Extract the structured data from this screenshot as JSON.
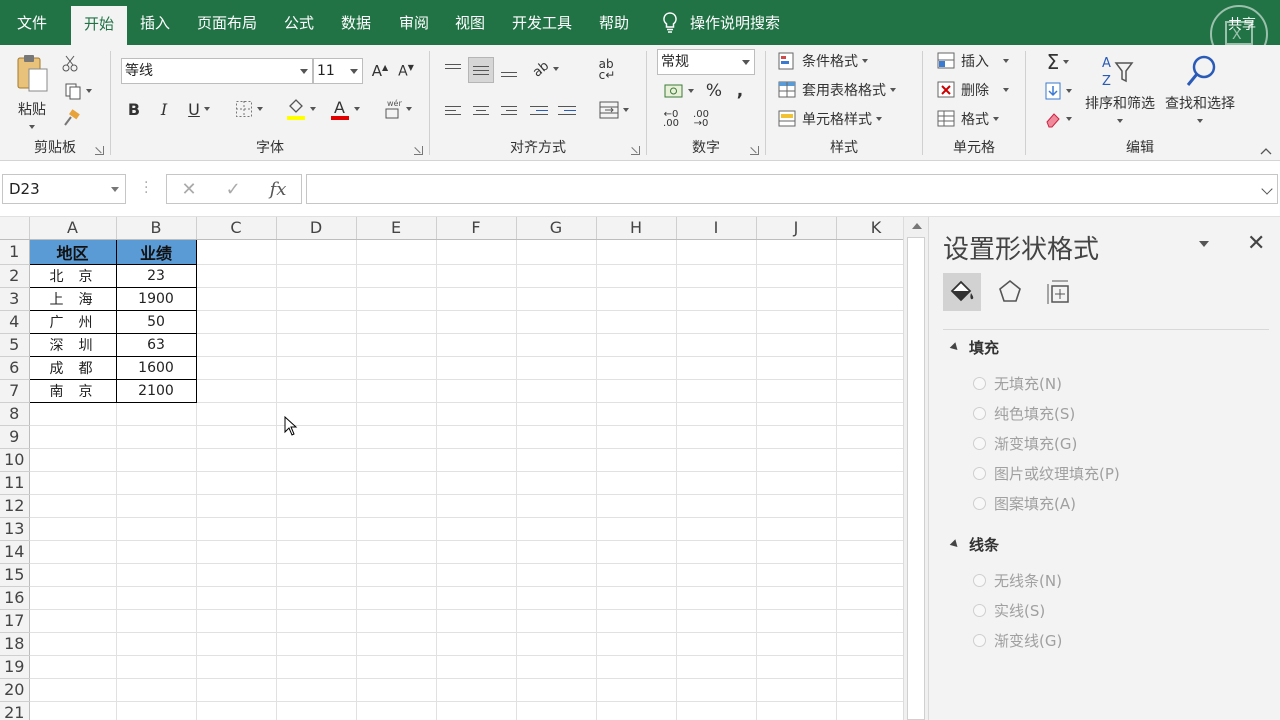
{
  "menu": {
    "tabs": [
      "文件",
      "开始",
      "插入",
      "页面布局",
      "公式",
      "数据",
      "审阅",
      "视图",
      "开发工具",
      "帮助"
    ],
    "active_tab": "开始",
    "tell_me": "操作说明搜索",
    "share": "共享",
    "brand_color": "#217346"
  },
  "ribbon": {
    "clipboard": {
      "label": "剪贴板",
      "paste": "粘贴"
    },
    "font": {
      "label": "字体",
      "font_name": "等线",
      "font_size": "11"
    },
    "alignment": {
      "label": "对齐方式"
    },
    "number": {
      "label": "数字",
      "format": "常规"
    },
    "styles": {
      "label": "样式",
      "conditional": "条件格式",
      "table": "套用表格格式",
      "cell": "单元格样式"
    },
    "cells": {
      "label": "单元格",
      "insert": "插入",
      "delete": "删除",
      "format": "格式"
    },
    "editing": {
      "label": "编辑",
      "sort": "排序和筛选",
      "find": "查找和选择"
    }
  },
  "formula_bar": {
    "name_box": "D23",
    "formula": ""
  },
  "sheet": {
    "columns": [
      "A",
      "B",
      "C",
      "D",
      "E",
      "F",
      "G",
      "H",
      "I",
      "J",
      "K"
    ],
    "header_row": [
      "地区",
      "业绩"
    ],
    "rows": [
      [
        "北京",
        "23"
      ],
      [
        "上海",
        "1900"
      ],
      [
        "广州",
        "50"
      ],
      [
        "深圳",
        "63"
      ],
      [
        "成都",
        "1600"
      ],
      [
        "南京",
        "2100"
      ]
    ],
    "row_count": 21,
    "header_fill": "#5b9bd5"
  },
  "pane": {
    "title": "设置形状格式",
    "fill": {
      "heading": "填充",
      "options": [
        "无填充(N)",
        "纯色填充(S)",
        "渐变填充(G)",
        "图片或纹理填充(P)",
        "图案填充(A)"
      ]
    },
    "line": {
      "heading": "线条",
      "options": [
        "无线条(N)",
        "实线(S)",
        "渐变线(G)"
      ]
    }
  }
}
